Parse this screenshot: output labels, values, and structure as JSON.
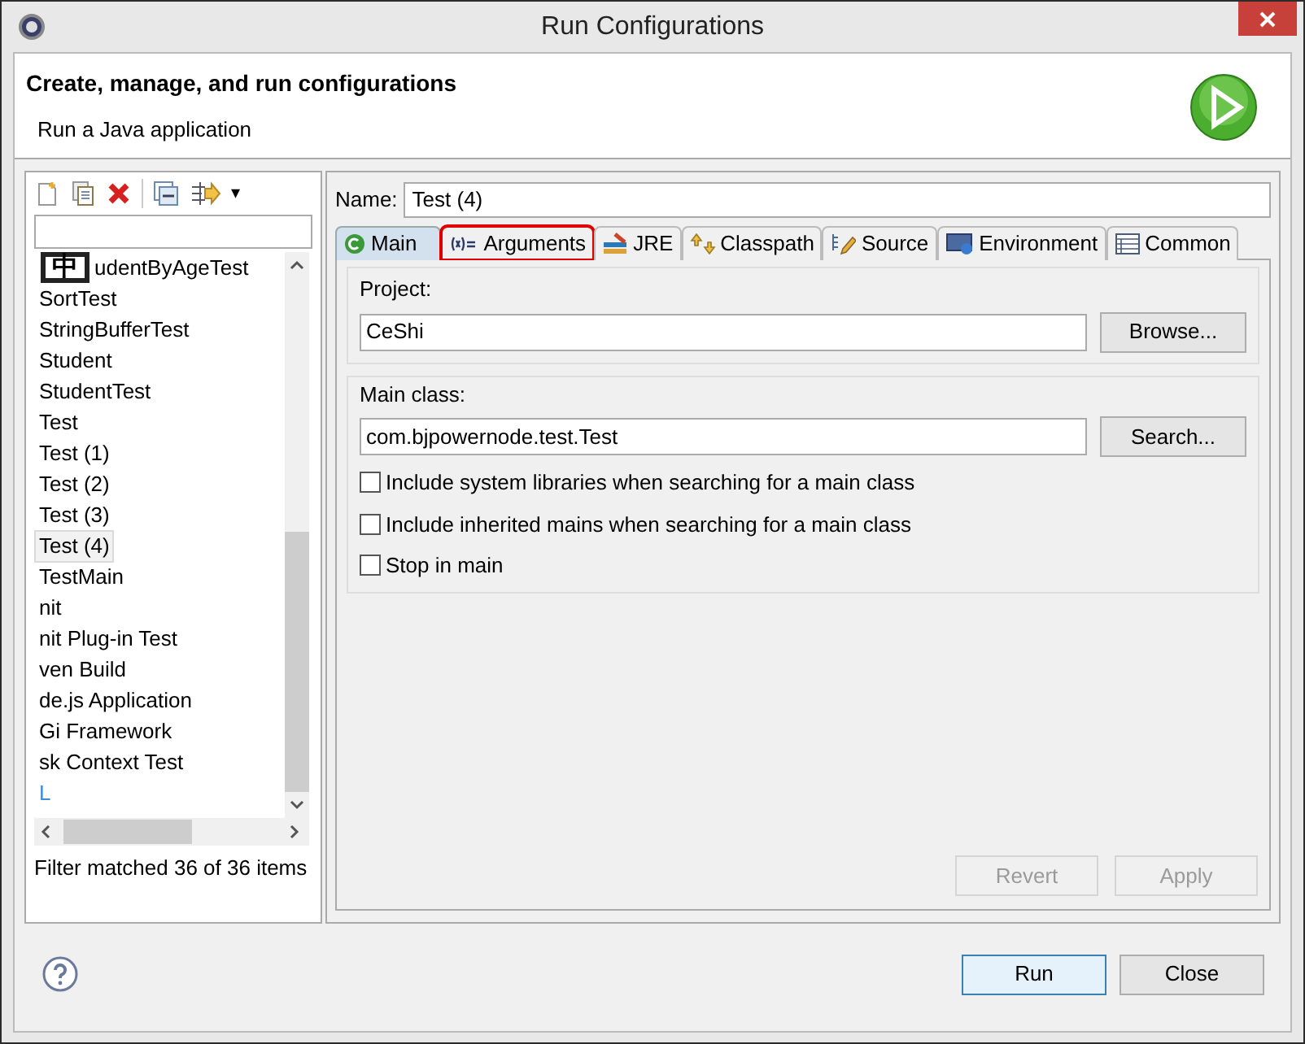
{
  "window": {
    "title": "Run Configurations"
  },
  "header": {
    "title": "Create, manage, and run configurations",
    "subtitle": "Run a Java application"
  },
  "toolbar": {
    "menu_glyph": "▾"
  },
  "ime_indicator": "中",
  "tree": {
    "items": [
      {
        "label": "udentByAgeTest",
        "selected": false
      },
      {
        "label": "SortTest",
        "selected": false
      },
      {
        "label": "StringBufferTest",
        "selected": false
      },
      {
        "label": "Student",
        "selected": false
      },
      {
        "label": "StudentTest",
        "selected": false
      },
      {
        "label": "Test",
        "selected": false
      },
      {
        "label": "Test (1)",
        "selected": false
      },
      {
        "label": "Test (2)",
        "selected": false
      },
      {
        "label": "Test (3)",
        "selected": false
      },
      {
        "label": "Test (4)",
        "selected": true
      },
      {
        "label": "TestMain",
        "selected": false
      },
      {
        "label": "nit",
        "selected": false
      },
      {
        "label": "nit Plug-in Test",
        "selected": false
      },
      {
        "label": "ven Build",
        "selected": false
      },
      {
        "label": "de.js Application",
        "selected": false
      },
      {
        "label": "Gi Framework",
        "selected": false
      },
      {
        "label": "sk Context Test",
        "selected": false
      },
      {
        "label": "L",
        "selected": false,
        "color": "#3c8cdc"
      }
    ]
  },
  "filter_status": "Filter matched 36 of 36 items",
  "name": {
    "label": "Name:",
    "value": "Test (4)"
  },
  "tabs": [
    {
      "kind": "main",
      "label": "Main",
      "selected": true,
      "highlighted": false
    },
    {
      "kind": "arguments",
      "label": "Arguments",
      "selected": false,
      "highlighted": true
    },
    {
      "kind": "jre",
      "label": "JRE",
      "selected": false,
      "highlighted": false
    },
    {
      "kind": "classpath",
      "label": "Classpath",
      "selected": false,
      "highlighted": false
    },
    {
      "kind": "source",
      "label": "Source",
      "selected": false,
      "highlighted": false
    },
    {
      "kind": "environment",
      "label": "Environment",
      "selected": false,
      "highlighted": false
    },
    {
      "kind": "common",
      "label": "Common",
      "selected": false,
      "highlighted": false
    }
  ],
  "project": {
    "label": "Project:",
    "value": "CeShi",
    "button": "Browse..."
  },
  "main_class": {
    "label": "Main class:",
    "value": "com.bjpowernode.test.Test",
    "button": "Search..."
  },
  "options": [
    {
      "label": "Include system libraries when searching for a main class",
      "checked": false
    },
    {
      "label": "Include inherited mains when searching for a main class",
      "checked": false
    },
    {
      "label": "Stop in main",
      "checked": false
    }
  ],
  "form_buttons": [
    {
      "label": "Revert",
      "disabled": true
    },
    {
      "label": "Apply",
      "disabled": true
    }
  ],
  "dialog_buttons": [
    {
      "label": "Run",
      "default": true
    },
    {
      "label": "Close",
      "default": false
    }
  ]
}
